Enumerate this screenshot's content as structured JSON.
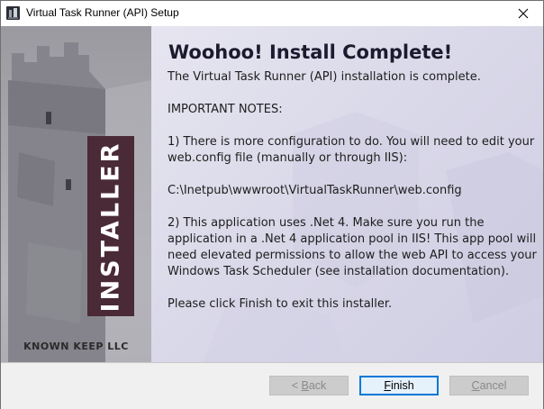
{
  "window": {
    "title": "Virtual Task Runner (API) Setup",
    "close_glyph": "✕"
  },
  "sidebar": {
    "banner_text": "INSTALLER",
    "company": "KNOWN KEEP LLC"
  },
  "main": {
    "heading": "Woohoo! Install Complete!",
    "paragraphs": [
      "The Virtual Task Runner (API) installation is complete.",
      "IMPORTANT NOTES:",
      "1) There is more configuration to do. You will need to edit your web.config file (manually or through IIS):",
      "C:\\Inetpub\\wwwroot\\VirtualTaskRunner\\web.config",
      "2) This application uses .Net 4. Make sure you run the application in a .Net 4 application pool in IIS! This app pool will need elevated permissions to allow the web API to access your Windows Task Scheduler (see installation documentation).",
      "Please click Finish to exit this installer."
    ]
  },
  "buttons": {
    "back": {
      "prefix": "< ",
      "mnemonic": "B",
      "rest": "ack",
      "enabled": false
    },
    "finish": {
      "mnemonic": "F",
      "rest": "inish",
      "enabled": true
    },
    "cancel": {
      "mnemonic": "C",
      "rest": "ancel",
      "enabled": false
    }
  },
  "colors": {
    "banner": "#4a2a36",
    "heading": "#1b1a2e",
    "content_bg": "#dcdbe8"
  },
  "icons": {
    "app": "app-icon",
    "close": "close-icon"
  }
}
